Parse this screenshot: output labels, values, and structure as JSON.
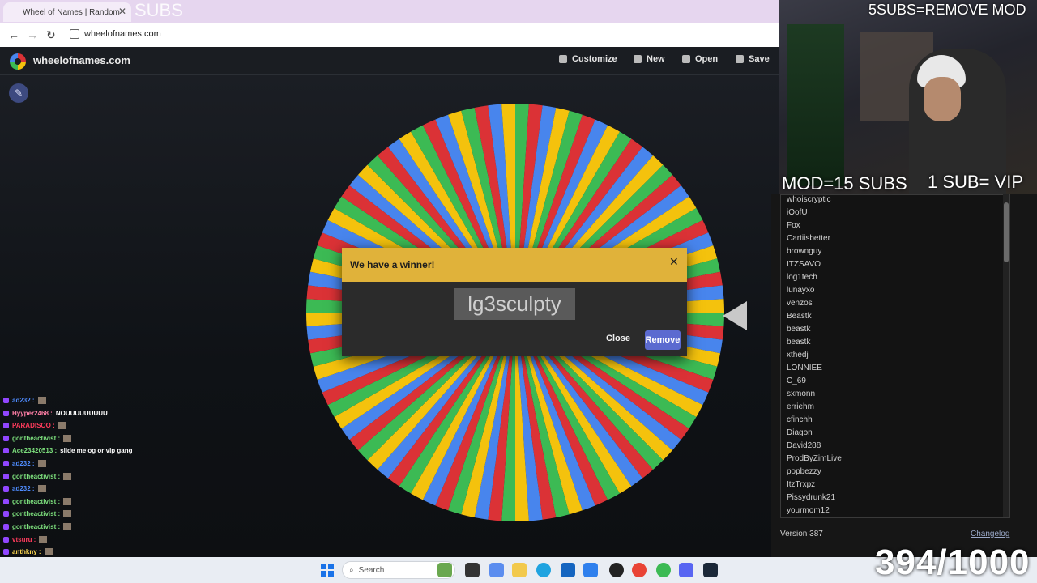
{
  "browser": {
    "tab_title": "Wheel of Names | Random",
    "subs_overlay": "SUBS",
    "url": "wheelofnames.com"
  },
  "app": {
    "brand": "wheelofnames.com",
    "menu": [
      "Customize",
      "New",
      "Open",
      "Save"
    ]
  },
  "modal": {
    "title": "We have a winner!",
    "winner": "lg3sculpty",
    "close_label": "Close",
    "remove_label": "Remove"
  },
  "stream_overlay": {
    "top_right": "5SUBS=REMOVE MOD",
    "mod_text": "MOD=15 SUBS",
    "vip_text": "1 SUB= VIP",
    "counter": "394/1000"
  },
  "names_panel": {
    "names": [
      "whoiscryptic",
      "iOofU",
      "Fox",
      "Cartiisbetter",
      "brownguy",
      "ITZSAVO",
      "log1tech",
      "lunayxo",
      "venzos",
      "Beastk",
      "beastk",
      "beastk",
      "xthedj",
      "LONNIEE",
      "C_69",
      "sxmonn",
      "erriehm",
      "cfinchh",
      "Diagon",
      "David288",
      "ProdByZimLive",
      "popbezzy",
      "ItzTrxpz",
      "Pissydrunk21",
      "yourmom12"
    ],
    "version": "Version 387",
    "changelog": "Changelog"
  },
  "chat": [
    {
      "user": "ad232",
      "msg": "",
      "color": "#4f8cff"
    },
    {
      "user": "Hyyper2468",
      "msg": "NOUUUUUUUUU",
      "color": "#ff7fa6"
    },
    {
      "user": "PARADISOO",
      "msg": "",
      "color": "#ff3b5c"
    },
    {
      "user": "gontheactivist",
      "msg": "",
      "color": "#7de07d"
    },
    {
      "user": "Ace23420513",
      "msg": "slide me og or vip gang",
      "color": "#7de07d"
    },
    {
      "user": "ad232",
      "msg": "",
      "color": "#4f8cff"
    },
    {
      "user": "gontheactivist",
      "msg": "",
      "color": "#7de07d"
    },
    {
      "user": "ad232",
      "msg": "",
      "color": "#4f8cff"
    },
    {
      "user": "gontheactivist",
      "msg": "",
      "color": "#7de07d"
    },
    {
      "user": "gontheactivist",
      "msg": "",
      "color": "#7de07d"
    },
    {
      "user": "gontheactivist",
      "msg": "",
      "color": "#7de07d"
    },
    {
      "user": "vtsuru",
      "msg": "",
      "color": "#ff3b5c"
    },
    {
      "user": "anthkny",
      "msg": "",
      "color": "#ffd84f"
    }
  ],
  "wheel": {
    "colors": [
      "#3cba54",
      "#db3236",
      "#4885ed",
      "#f4c20d"
    ]
  },
  "taskbar": {
    "search_label": "Search"
  }
}
